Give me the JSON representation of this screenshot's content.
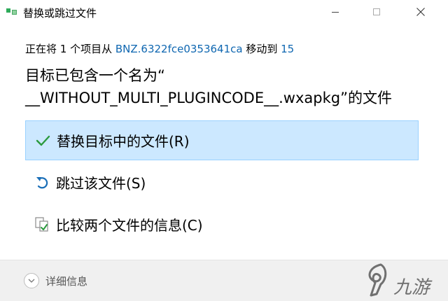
{
  "window": {
    "title": "替换或跳过文件",
    "icon": "file-move-icon",
    "controls": {
      "minimize": "minimize-icon",
      "maximize": "maximize-icon",
      "close": "close-icon"
    }
  },
  "status": {
    "prefix": "正在将 1 个项目从 ",
    "source": "BNZ.6322fce0353641ca",
    "middle": " 移动到 ",
    "destination": "15"
  },
  "headline": {
    "line1": "目标已包含一个名为“",
    "line2": "__WITHOUT_MULTI_PLUGINCODE__.wxapkg”的文件"
  },
  "options": [
    {
      "label": "替换目标中的文件(R)",
      "icon": "check-icon",
      "selected": true
    },
    {
      "label": "跳过该文件(S)",
      "icon": "undo-arrow-icon",
      "selected": false
    },
    {
      "label": "比较两个文件的信息(C)",
      "icon": "compare-files-icon",
      "selected": false
    }
  ],
  "footer": {
    "details_label": "详细信息",
    "icon": "chevron-down-icon"
  },
  "watermark": {
    "text": "九游"
  },
  "colors": {
    "link": "#0f67b1",
    "selected_bg": "#cce8ff",
    "selected_border": "#99d1ff",
    "check": "#2b9a3e",
    "footer_bg": "#f0f0f0"
  }
}
